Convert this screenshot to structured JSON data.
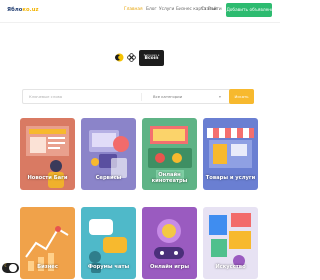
{
  "header": {
    "logo_left": "Ябло",
    "logo_right": "ко.uz",
    "nav": [
      {
        "label": "Главная",
        "active": true
      },
      {
        "label": "Блог",
        "active": false
      },
      {
        "label": "Услуги",
        "active": false
      },
      {
        "label": "Бизнес карта",
        "active": false
      },
      {
        "label": "Статьи",
        "active": false
      }
    ],
    "login": "Войти",
    "add_button": "+ Добавить объявление"
  },
  "badges": {
    "wide_small": "Загрузите в",
    "wide_big": "Bcoin"
  },
  "search": {
    "placeholder": "Ключевые слова",
    "category": "Все категории",
    "button": "Искать"
  },
  "categories": [
    {
      "label": "Новости Баги"
    },
    {
      "label": "Сервисы"
    },
    {
      "label": "Онлайн\nкинотеатры"
    },
    {
      "label": "Товары и услуги"
    },
    {
      "label": "Бизнес"
    },
    {
      "label": "Форумы чаты"
    },
    {
      "label": "Онлайн игры"
    },
    {
      "label": "Искусство"
    }
  ],
  "icons": {
    "badge1": "yellow-coin-icon",
    "badge2": "clover-icon",
    "toggle": "moon-icon"
  },
  "colors": {
    "accent_yellow": "#f7b92e",
    "accent_green": "#2dbb70",
    "active_nav": "#e6a100"
  }
}
